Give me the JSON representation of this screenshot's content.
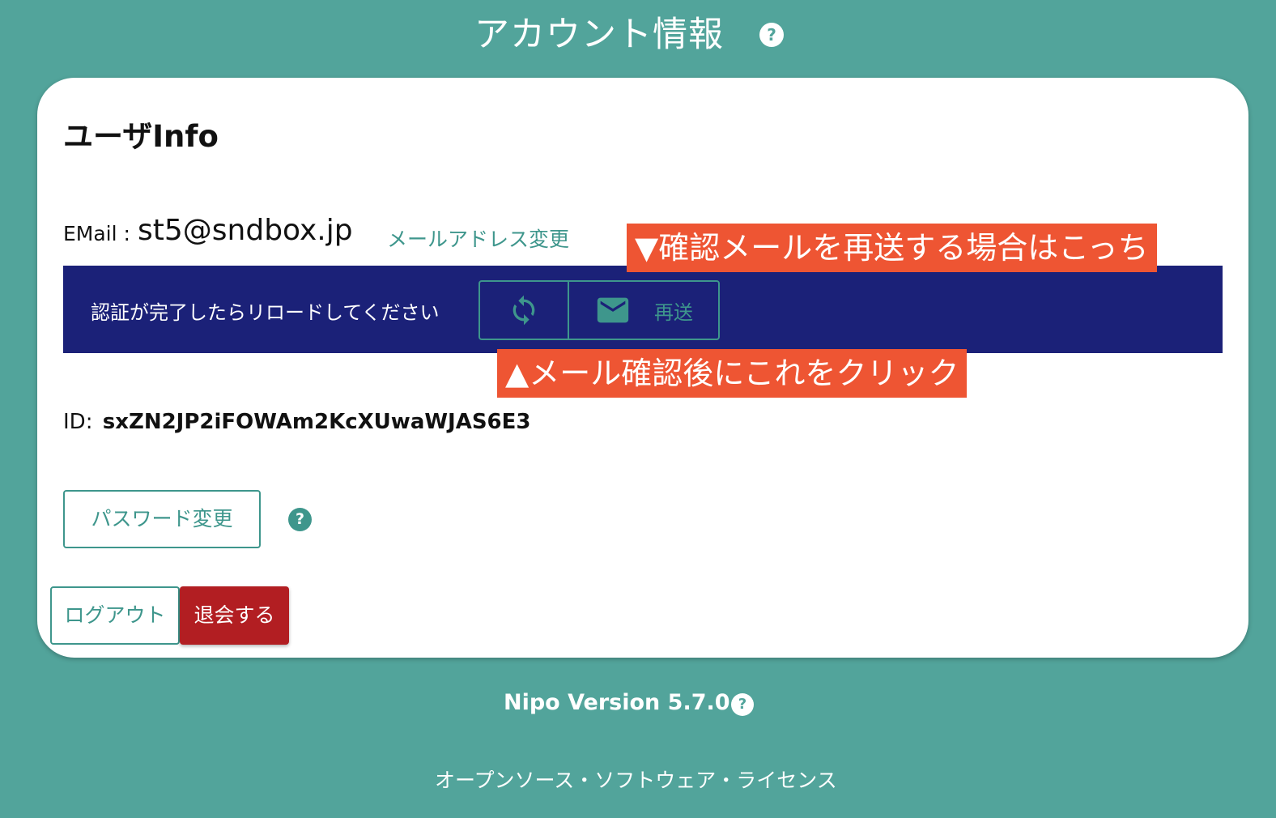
{
  "header": {
    "title": "アカウント情報",
    "help_glyph": "?",
    "help_icon": "help-circle-icon"
  },
  "card": {
    "title": "ユーザInfo",
    "email": {
      "label": "EMail :",
      "value": "st5@sndbox.jp",
      "change_link": "メールアドレス変更"
    },
    "verify": {
      "message": "認証が完了したらリロードしてください",
      "reload_icon": "reload-icon",
      "resend_icon": "mail-icon",
      "resend_label": "再送"
    },
    "annotations": {
      "resend_note": "▼確認メールを再送する場合はこっち",
      "reload_note": "▲メール確認後にこれをクリック"
    },
    "id": {
      "label": "ID:",
      "value": "sxZN2JP2iFOWAm2KcXUwaWJAS6E3"
    },
    "password_button": "パスワード変更",
    "password_help_glyph": "?",
    "logout_button": "ログアウト",
    "withdraw_button": "退会する"
  },
  "footer": {
    "version": "Nipo Version 5.7.0",
    "help_glyph": "?",
    "license_link": "オープンソース・ソフトウェア・ライセンス"
  },
  "colors": {
    "background": "#52a49b",
    "accent": "#3e968c",
    "verify_bar": "#1b2178",
    "annotation": "#ee5533",
    "danger": "#b21e22"
  }
}
